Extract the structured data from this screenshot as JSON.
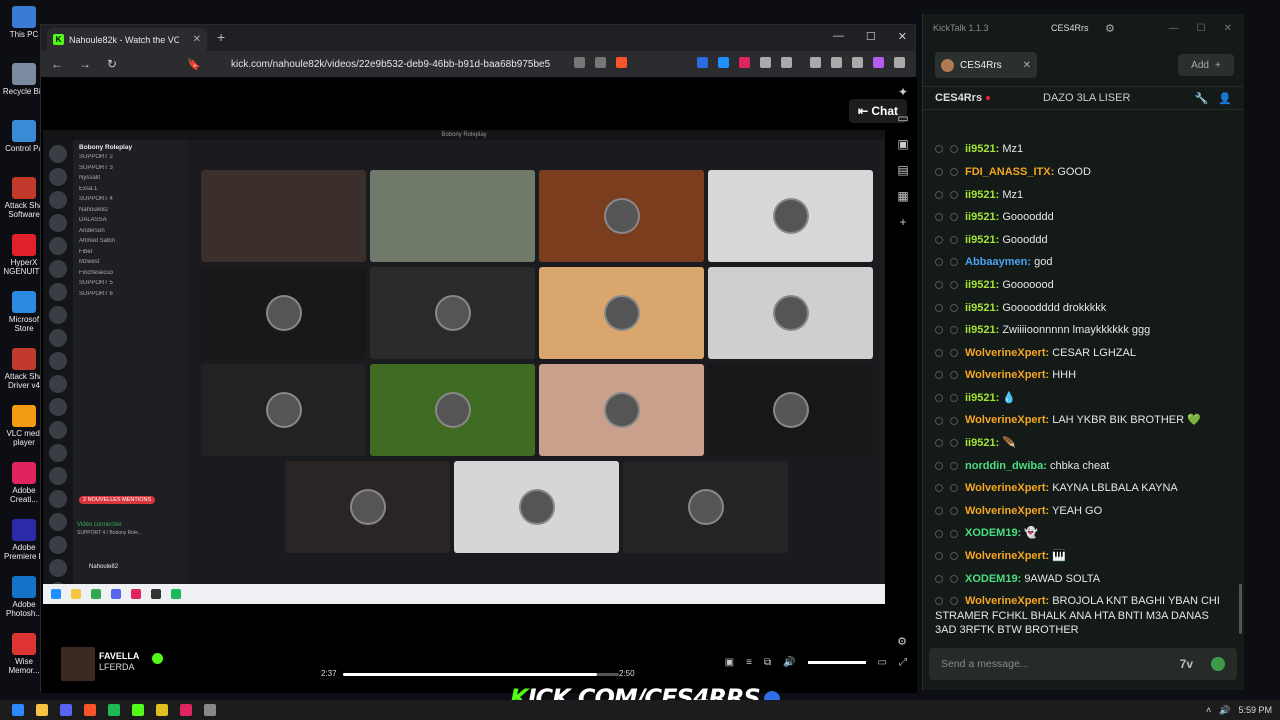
{
  "desktop": {
    "icons": [
      {
        "label": "This PC",
        "color": "#3a7bd5"
      },
      {
        "label": "Recycle Bin",
        "color": "#7a8ba0"
      },
      {
        "label": "Control Pa",
        "color": "#3a8bd5"
      },
      {
        "label": "Attack Sha Software",
        "color": "#c0392b"
      },
      {
        "label": "HyperX NGENUITY",
        "color": "#e0202a"
      },
      {
        "label": "Microsof Store",
        "color": "#2a8ae0"
      },
      {
        "label": "Attack Sha Driver v4",
        "color": "#c0392b"
      },
      {
        "label": "VLC medi player",
        "color": "#f39c12"
      },
      {
        "label": "Adobe Creati...",
        "color": "#e0245e"
      },
      {
        "label": "Adobe Premiere P",
        "color": "#2b2ba8"
      },
      {
        "label": "Adobe Photosh...",
        "color": "#1473c6"
      },
      {
        "label": "Wise Memor...",
        "color": "#d33"
      }
    ]
  },
  "browser": {
    "tab_title": "Nahoule82k - Watch the VOD",
    "url": "kick.com/nahoule82k/videos/22e9b532-deb9-46bb-b91d-baa68b975be5",
    "chat_button": "Chat"
  },
  "video": {
    "window_title": "Bobony Roleplay",
    "server_name": "Bobony Roleplay",
    "channels": [
      "SUPPORT 2",
      "SUPPORT 3",
      "Nyssalit",
      "Exsa.1",
      "SUPPORT 4",
      "Nahoule82",
      "DALASSA",
      "Anderson",
      "Ahmed Sabiri",
      "Fiber",
      "Mzwest",
      "Flochesecuo",
      "SUPPORT 5",
      "SUPPORT 6"
    ],
    "badges": {
      "live": "EN DIRECT",
      "new": "NOUVEAU",
      "mentions": "2 NOUVELLES MENTIONS"
    },
    "voice_status": "Vidéo connectée",
    "voice_channel": "SUPPORT 4 / Bobony Role...",
    "user": "Nahoule82",
    "tiles": [
      {
        "bg": "#3a2f2a"
      },
      {
        "bg": "#6f7a6a"
      },
      {
        "bg": "#7a3e1e"
      },
      {
        "bg": "#d8d8d8"
      },
      {
        "bg": "#181818"
      },
      {
        "bg": "#2a2a2a"
      },
      {
        "bg": "#d9a66e"
      },
      {
        "bg": "#cfcfcf"
      },
      {
        "bg": "#222"
      },
      {
        "bg": "#3f6b22"
      },
      {
        "bg": "#c8a08c"
      },
      {
        "bg": "#171717"
      },
      {
        "bg": "#2b2424"
      },
      {
        "bg": "#d6d6d6"
      },
      {
        "bg": "#242424"
      }
    ]
  },
  "player": {
    "streamer_name": "FAVELLA",
    "streamer_sub": "LFERDA",
    "current_time": "2:37",
    "duration": "2:50",
    "progress": 0.92
  },
  "kicktalk": {
    "app_title": "KickTalk 1.1.3",
    "account": "CES4Rrs",
    "tab": "CES4Rrs",
    "add_label": "Add",
    "channel": "CES4Rrs",
    "stream_title": "DAZO 3LA LISER",
    "input_placeholder": "Send a message...",
    "messages": [
      {
        "user": "ii9521:",
        "color": "#a3e635",
        "text": "Mz1"
      },
      {
        "user": "FDI_ANASS_ITX:",
        "color": "#f5a623",
        "text": "GOOD"
      },
      {
        "user": "ii9521:",
        "color": "#a3e635",
        "text": "Mz1"
      },
      {
        "user": "ii9521:",
        "color": "#a3e635",
        "text": "Gooooddd"
      },
      {
        "user": "ii9521:",
        "color": "#a3e635",
        "text": "Goooddd"
      },
      {
        "user": "Abbaaymen:",
        "color": "#4aa3f0",
        "text": "god"
      },
      {
        "user": "ii9521:",
        "color": "#a3e635",
        "text": "Gooooood"
      },
      {
        "user": "ii9521:",
        "color": "#a3e635",
        "text": "Goooodddd drokkkkk"
      },
      {
        "user": "ii9521:",
        "color": "#a3e635",
        "text": "Zwiiiioonnnnn lmaykkkkkk ggg"
      },
      {
        "user": "WolverineXpert:",
        "color": "#f5a623",
        "text": "CESAR LGHZAL"
      },
      {
        "user": "WolverineXpert:",
        "color": "#f5a623",
        "text": "HHH"
      },
      {
        "user": "ii9521:",
        "color": "#a3e635",
        "text": "💧"
      },
      {
        "user": "WolverineXpert:",
        "color": "#f5a623",
        "text": "LAH YKBR BIK BROTHER 💚"
      },
      {
        "user": "ii9521:",
        "color": "#a3e635",
        "text": "🪶"
      },
      {
        "user": "norddin_dwiba:",
        "color": "#4ade80",
        "text": "chbka cheat"
      },
      {
        "user": "WolverineXpert:",
        "color": "#f5a623",
        "text": "KAYNA LBLBALA KAYNA"
      },
      {
        "user": "WolverineXpert:",
        "color": "#f5a623",
        "text": "YEAH GO"
      },
      {
        "user": "XODEM19:",
        "color": "#4ade80",
        "text": "👻"
      },
      {
        "user": "WolverineXpert:",
        "color": "#f5a623",
        "text": "🎹"
      },
      {
        "user": "XODEM19:",
        "color": "#4ade80",
        "text": "9AWAD SOLTA"
      },
      {
        "user": "WolverineXpert:",
        "color": "#f5a623",
        "text": "BROJOLA KNT BAGHI YBAN CHI STRAMER FCHKL BHALK ANA HTA BNTI M3A DANAS 3AD 3RFTK BTW BROTHER"
      }
    ]
  },
  "watermark": {
    "prefix": "K",
    "text": "ICK.COM/CES4RRS"
  },
  "taskbar": {
    "time": "5:59 PM"
  }
}
